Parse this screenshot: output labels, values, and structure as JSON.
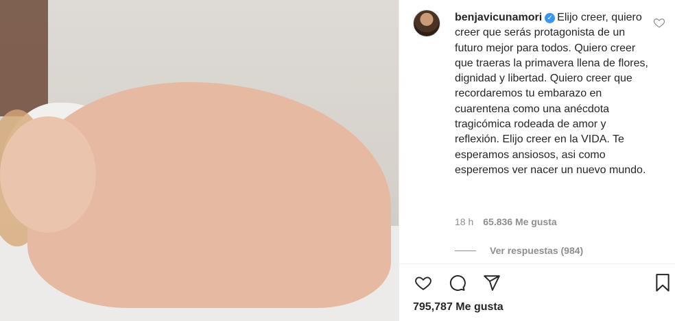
{
  "post": {
    "photo": {
      "alt": "Photo"
    },
    "caption": {
      "username": "benjavicunamori",
      "verified_icon": "verified-badge-icon",
      "text": "Elijo creer, quiero creer que serás protagonista de un futuro mejor para todos. Quiero creer que traeras la primavera llena de flores, dignidad y libertad. Quiero creer que recordaremos tu embarazo en cuarentena como una anécdota tragicómica rodeada de amor y reflexión. Elijo creer en la VIDA. Te esperamos ansiosos, asi como esperemos ver nacer un nuevo mundo.",
      "time": "18 h",
      "likes": "65.836 Me gusta",
      "view_replies": "Ver respuestas (984)"
    },
    "actions": {
      "like_icon": "heart-icon",
      "comment_icon": "comment-icon",
      "share_icon": "share-icon",
      "save_icon": "bookmark-icon"
    },
    "total_likes": "795,787 Me gusta"
  },
  "colors": {
    "text": "#262626",
    "secondary": "#8e8e8e",
    "verified": "#3897f0",
    "divider": "#efefef"
  }
}
